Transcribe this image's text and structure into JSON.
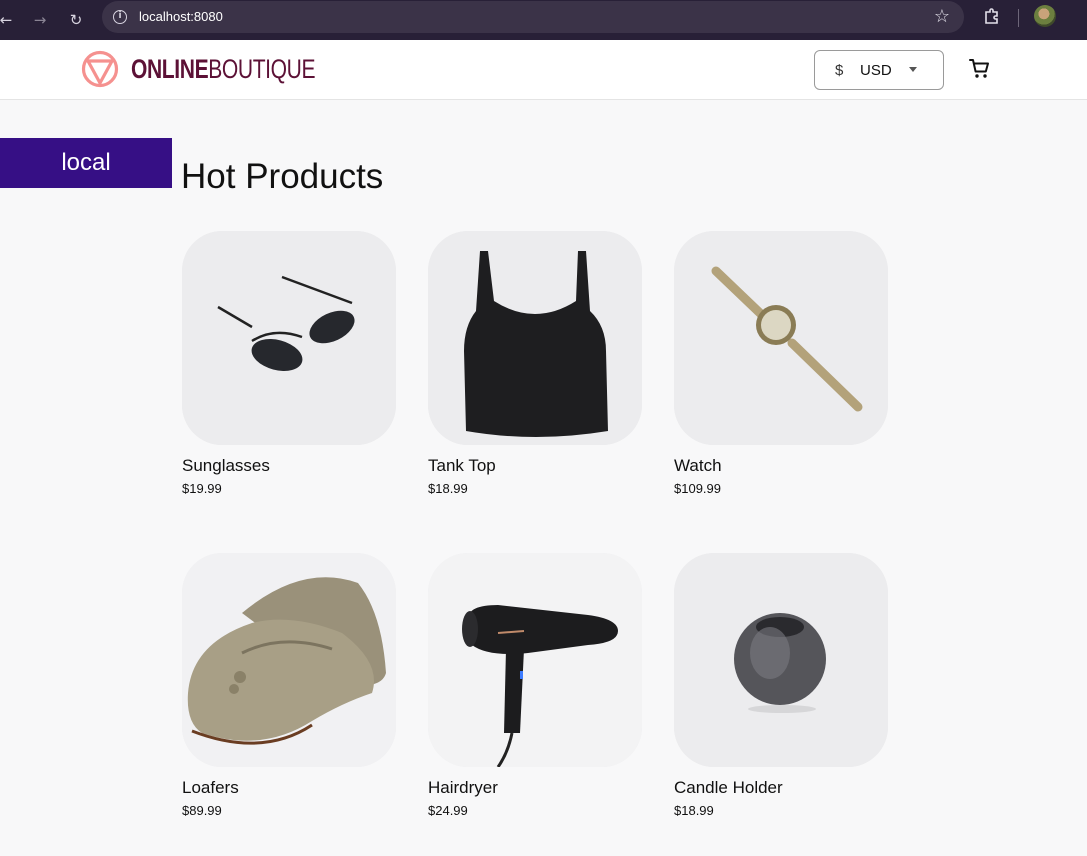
{
  "browser": {
    "url": "localhost:8080",
    "icons": {
      "back": "arrow-left-icon",
      "forward": "arrow-right-icon",
      "reload": "reload-icon",
      "info": "info-icon",
      "bookmark": "star-icon",
      "extensions": "puzzle-icon",
      "profile": "avatar"
    }
  },
  "header": {
    "logo_bold": "ONLINE",
    "logo_light": "BOUTIQUE",
    "currency": {
      "symbol": "$",
      "selected": "USD"
    },
    "cart_icon": "cart-icon",
    "brand_color": "#5c1136",
    "logo_color": "#f5918f"
  },
  "env_badge": {
    "label": "local",
    "color": "#360f85"
  },
  "main": {
    "title": "Hot Products",
    "products": [
      {
        "name": "Sunglasses",
        "price": "$19.99"
      },
      {
        "name": "Tank Top",
        "price": "$18.99"
      },
      {
        "name": "Watch",
        "price": "$109.99"
      },
      {
        "name": "Loafers",
        "price": "$89.99"
      },
      {
        "name": "Hairdryer",
        "price": "$24.99"
      },
      {
        "name": "Candle Holder",
        "price": "$18.99"
      }
    ]
  }
}
